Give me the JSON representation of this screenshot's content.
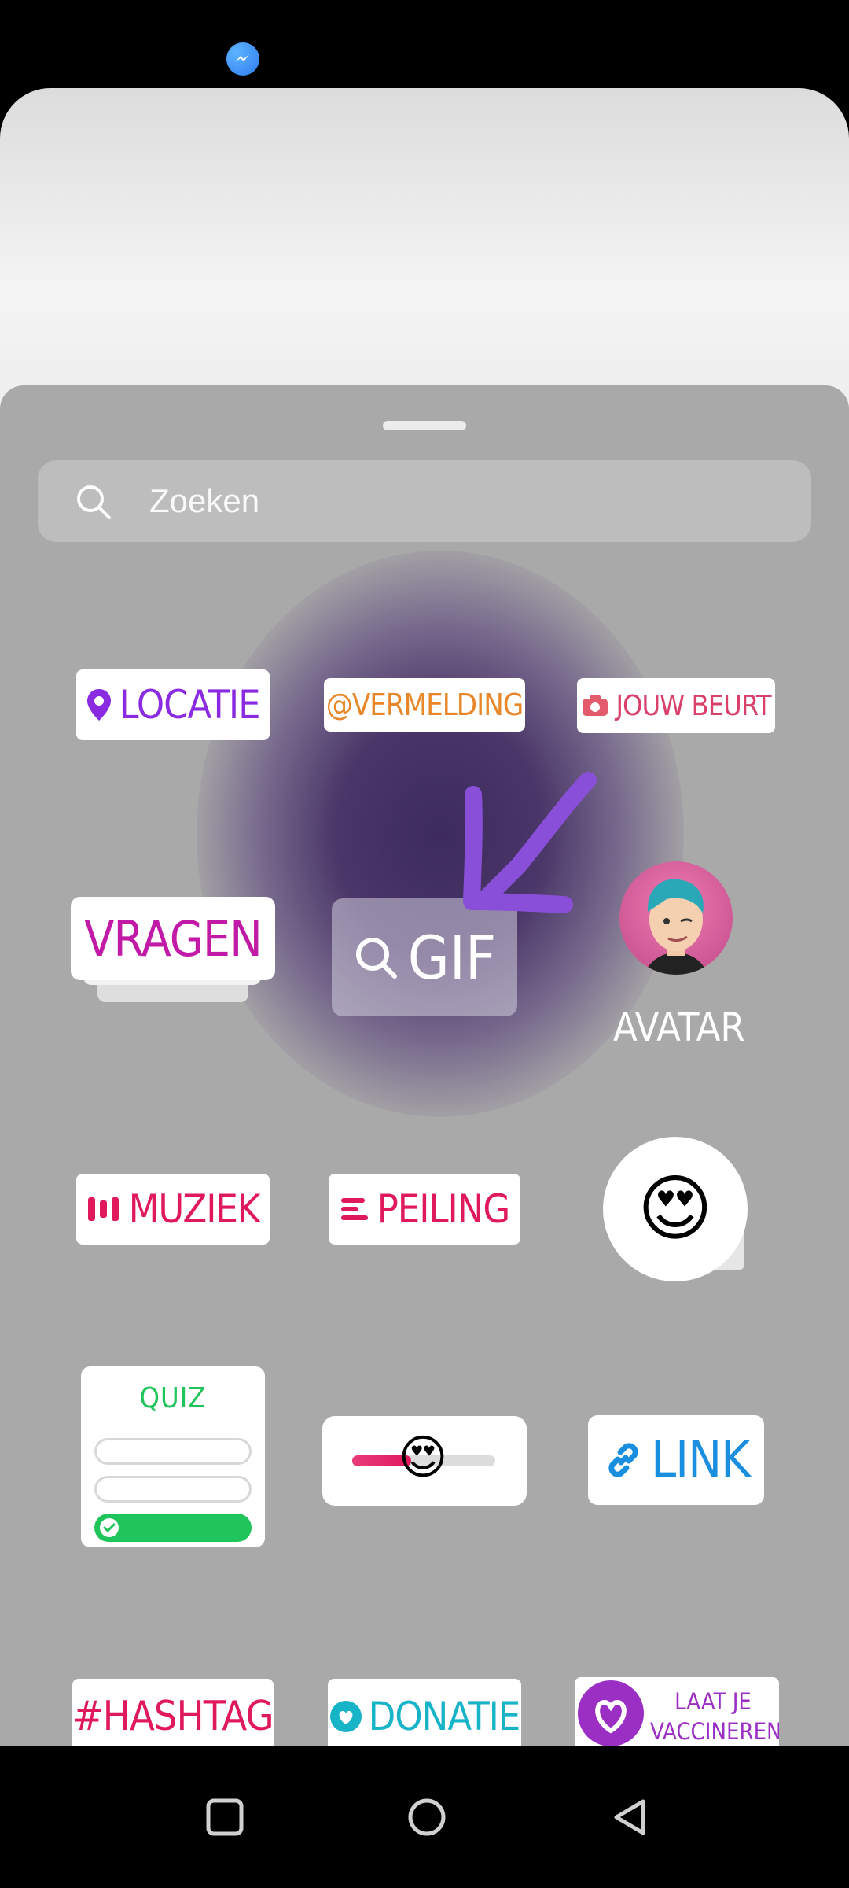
{
  "search": {
    "placeholder": "Zoeken"
  },
  "stickers": {
    "location": "LOCATIE",
    "mention": "@VERMELDING",
    "your_turn": "JOUW BEURT",
    "questions": "VRAGEN",
    "gif": "GIF",
    "avatar": "AVATAR",
    "music": "MUZIEK",
    "poll": "PEILING",
    "emoji_reaction": "😍",
    "quiz": "QUIZ",
    "slider_emoji": "😍",
    "link": "LINK",
    "hashtag": "#HASHTAG",
    "donation": "DONATIE",
    "vaccinate_line1": "LAAT JE",
    "vaccinate_line2": "VACCINEREN"
  },
  "colors": {
    "location": "#8a2be2",
    "mention": "#e8872a",
    "your_turn": "#d9406a",
    "questions": "#c01aa6",
    "music": "#e0185c",
    "poll": "#e0185c",
    "quiz": "#1fc45a",
    "link": "#1a8fe0",
    "hashtag": "#e0185c",
    "donation": "#17b3c7",
    "vaccinate": "#9b2fc4",
    "annotation_arrow": "#8a4fd8"
  },
  "icons": [
    "messenger-icon",
    "search-icon",
    "location-pin-icon",
    "camera-icon",
    "gif-search-icon",
    "music-bars-icon",
    "poll-lines-icon",
    "check-icon",
    "link-icon",
    "heart-icon",
    "square-icon",
    "circle-icon",
    "back-triangle-icon"
  ],
  "slider": {
    "value": 0.3
  }
}
